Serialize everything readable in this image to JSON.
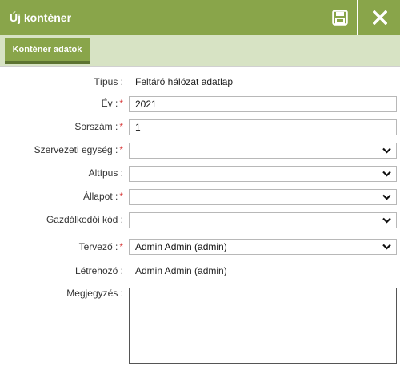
{
  "window": {
    "title": "Új konténer",
    "tab_label": "Konténer adatok",
    "colors": {
      "titlebar": "#89a54a",
      "tabstrip": "#d7e3c4",
      "required": "#d93b3b"
    }
  },
  "form": {
    "tipus": {
      "label": "Típus :",
      "value": "Feltáró hálózat adatlap"
    },
    "ev": {
      "label": "Év :",
      "value": "2021"
    },
    "sorszam": {
      "label": "Sorszám :",
      "value": "1"
    },
    "szervezeti_egyseg": {
      "label": "Szervezeti egység :",
      "value": ""
    },
    "altipus": {
      "label": "Altípus :",
      "value": ""
    },
    "allapot": {
      "label": "Állapot :",
      "value": ""
    },
    "gazdalkodoi_kod": {
      "label": "Gazdálkodói kód :",
      "value": ""
    },
    "tervezo": {
      "label": "Tervező :",
      "value": "Admin Admin (admin)"
    },
    "letrehozo": {
      "label": "Létrehozó :",
      "value": "Admin Admin (admin)"
    },
    "megjegyzes": {
      "label": "Megjegyzés :",
      "value": ""
    },
    "required_mark": "*"
  },
  "icons": {
    "save": "save-icon",
    "close": "close-icon",
    "dropdown": "chevron-down-icon"
  }
}
